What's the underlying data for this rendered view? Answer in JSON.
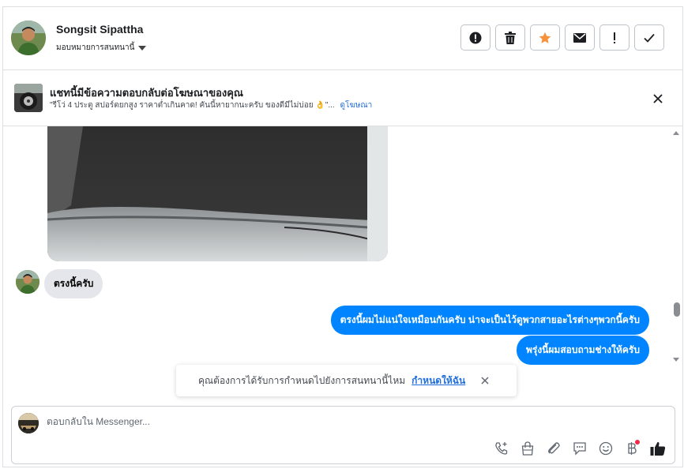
{
  "header": {
    "contact_name": "Songsit Sipattha",
    "assign_label": "มอบหมายการสนทนานี้",
    "actions": [
      {
        "name": "mark-spam-button",
        "icon": "alert-circle-icon"
      },
      {
        "name": "delete-button",
        "icon": "trash-icon"
      },
      {
        "name": "star-button",
        "icon": "star-icon"
      },
      {
        "name": "mark-unread-button",
        "icon": "envelope-icon"
      },
      {
        "name": "follow-up-button",
        "icon": "exclamation-icon"
      },
      {
        "name": "mark-done-button",
        "icon": "check-icon"
      }
    ],
    "star_color": "#f7923b"
  },
  "ad_banner": {
    "title": "แชทนี้มีข้อความตอบกลับต่อโฆษณาของคุณ",
    "subtitle": "\"รีโว่ 4 ประตู สปอร์ตยกสูง ราคาต่ำเกินคาด! คันนี้หายากนะครับ ของดีมีไม่บ่อย 👌\"...",
    "link_label": "ดูโฆษณา"
  },
  "messages": {
    "incoming_1": "ตรงนี้ครับ",
    "outgoing_1": "ตรงนี้ผมไม่แน่ใจเหมือนกันครับ น่าจะเป็นไว้ดูพวกสายอะไรต่างๆพวกนี้ครับ",
    "outgoing_2": "พรุ่งนี้ผมสอบถามช่างให้ครับ"
  },
  "toast": {
    "text": "คุณต้องการได้รับการกำหนดไปยังการสนทนานี้ไหม",
    "link_label": "กำหนดให้ฉัน"
  },
  "composer": {
    "placeholder": "ตอบกลับใน Messenger...",
    "tools": [
      "call-add-icon",
      "shopping-bag-icon",
      "paperclip-icon",
      "chat-bubble-icon",
      "smiley-icon",
      "baht-icon",
      "thumbs-up-icon"
    ]
  },
  "colors": {
    "accent": "#0084ff",
    "link": "#216fdb",
    "notification_dot": "#f02849"
  }
}
